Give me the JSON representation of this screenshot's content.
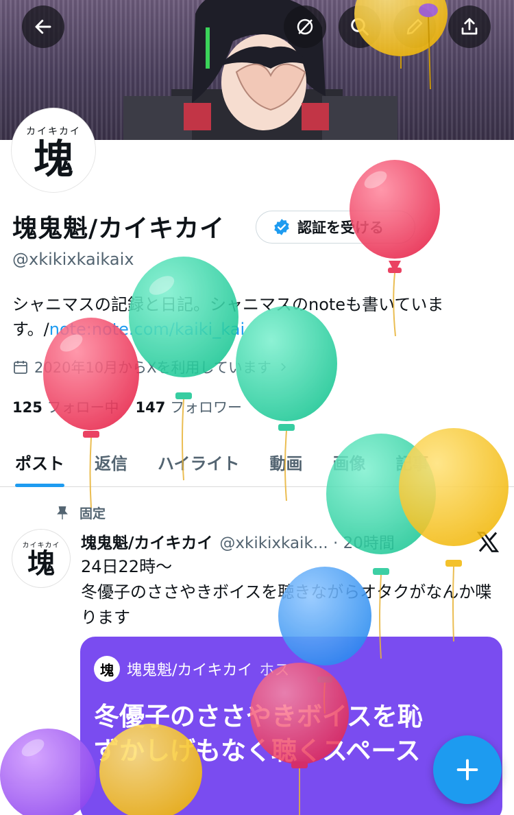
{
  "header": {
    "back_icon": "arrow-left-icon",
    "action_icons": [
      "mute-icon",
      "search-icon",
      "edit-icon",
      "share-icon"
    ]
  },
  "profile": {
    "avatar_kana": "カイキカイ",
    "avatar_kanji": "塊",
    "name": "塊鬼魁/カイキカイ",
    "verify_label": "認証を受ける",
    "handle": "@xkikixkaikaix",
    "bio_text": "シャニマスの記録と日記。シャニマスのnoteも書いています。/",
    "bio_link": "note:note.com/kaiki_kai",
    "joined": "2020年10月からXを利用しています",
    "following_count": "125",
    "following_label": "フォロー中",
    "followers_count": "147",
    "followers_label": "フォロワー"
  },
  "tabs": [
    "ポスト",
    "返信",
    "ハイライト",
    "動画",
    "画像",
    "記事"
  ],
  "post": {
    "pinned_label": "固定",
    "author": "塊鬼魁/カイキカイ",
    "handle_time": "@xkikixkaik... · 20時間",
    "text": "24日22時〜\n冬優子のささやきボイスを聴きながらオタクがなんか喋ります",
    "card_author": "塊鬼魁/カイキカイ",
    "card_suffix": "ホス",
    "card_title_line1": "冬優子のささやきボイスを恥",
    "card_title_line2": "ずかしげもなく聴くスペース"
  },
  "colors": {
    "accent": "#1d9bf0",
    "card_bg": "#7a4cf0",
    "balloon_red": "#ef3b5b",
    "balloon_green": "#2ed4a4",
    "balloon_yellow": "#f9c62b",
    "balloon_blue": "#3a97f0",
    "balloon_purple": "#a35ef0"
  },
  "fab_icon": "plus-icon"
}
